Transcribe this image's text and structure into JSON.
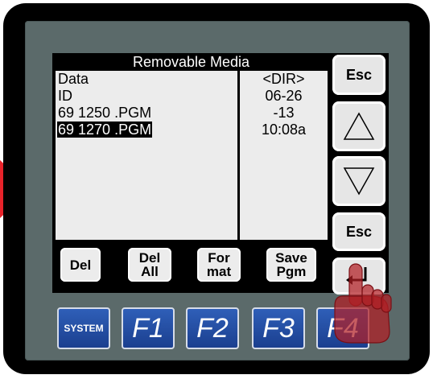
{
  "screen": {
    "title": "Removable Media",
    "files": [
      {
        "name": "Data",
        "selected": false
      },
      {
        "name": "ID",
        "selected": false
      },
      {
        "name": "69 1250 .PGM",
        "selected": false
      },
      {
        "name": "69 1270 .PGM",
        "selected": true
      }
    ],
    "info": [
      "<DIR>",
      "06-26",
      "-13",
      "10:08a"
    ]
  },
  "softkeys": [
    {
      "line1": "Del",
      "line2": ""
    },
    {
      "line1": "Del",
      "line2": "All"
    },
    {
      "line1": "For",
      "line2": "mat"
    },
    {
      "line1": "Save",
      "line2": "Pgm"
    }
  ],
  "side_buttons": {
    "esc_top": "Esc",
    "up_icon": "up-triangle-icon",
    "down_icon": "down-triangle-icon",
    "esc_bottom": "Esc",
    "enter_icon": "enter-arrow-icon"
  },
  "function_keys": [
    "SYSTEM",
    "F1",
    "F2",
    "F3",
    "F4"
  ],
  "colors": {
    "bezel": "#000000",
    "faceplate": "#5b6a6a",
    "lcd": "#ececec",
    "function_key": "#2f5fb8",
    "pointer": "#e8232a",
    "hand": "#b21e24"
  }
}
